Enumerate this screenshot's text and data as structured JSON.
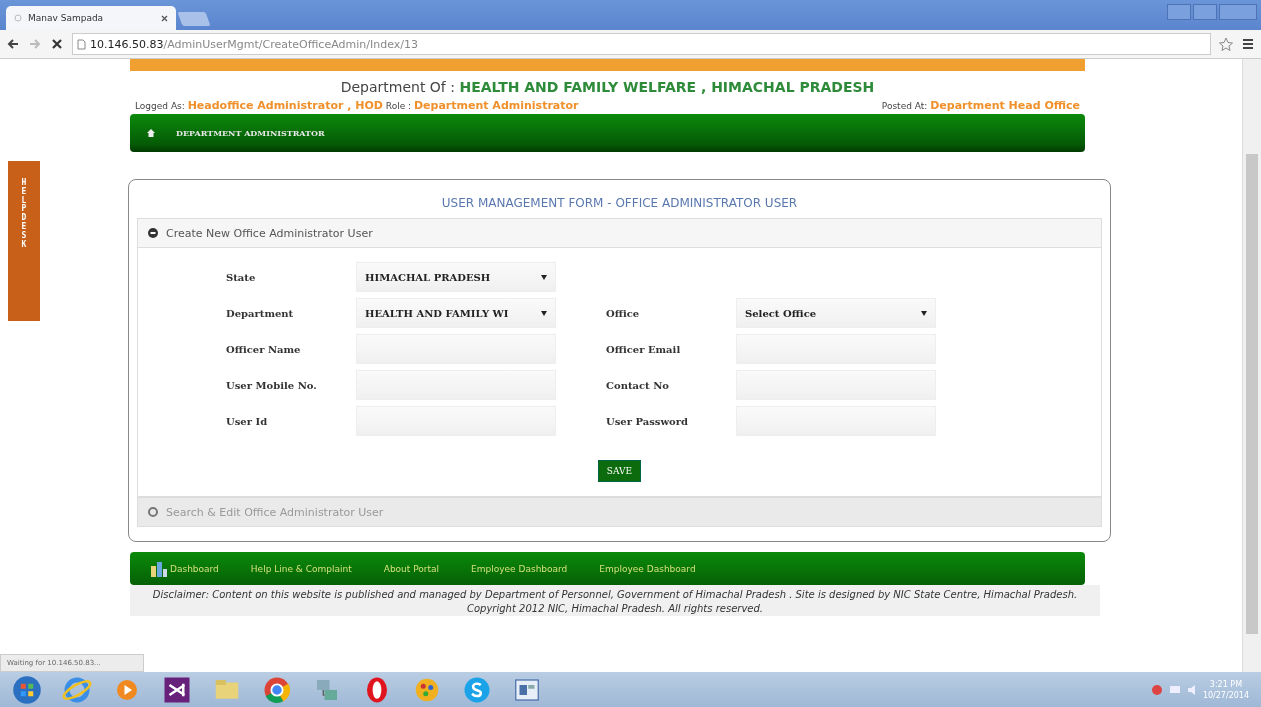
{
  "browser": {
    "tab_title": "Manav Sampada",
    "url_host": "10.146.50.83",
    "url_path": "/AdminUserMgmt/CreateOfficeAdmin/Index/13"
  },
  "header": {
    "department_prefix": "Department Of :",
    "department": "HEALTH AND FAMILY WELFARE , HIMACHAL PRADESH",
    "logged_as_label": "Logged As:",
    "logged_as": "Headoffice Administrator , HOD",
    "role_label": "Role :",
    "role": "Department Administrator",
    "posted_label": "Posted At:",
    "posted": "Department Head Office"
  },
  "help_desk": "HELP DESK",
  "nav": {
    "items": [
      "DEPARTMENT ADMINISTRATOR"
    ]
  },
  "form": {
    "title": "USER MANAGEMENT FORM - OFFICE ADMINISTRATOR USER",
    "sections": [
      {
        "title": "Create New Office Administrator User",
        "expanded": true
      },
      {
        "title": "Search & Edit Office Administrator User",
        "expanded": false
      }
    ],
    "rows": [
      {
        "cells": [
          {
            "label": "State",
            "kind": "select",
            "value": "HIMACHAL PRADESH"
          }
        ]
      },
      {
        "cells": [
          {
            "label": "Department",
            "kind": "select",
            "value": "HEALTH AND FAMILY WI"
          },
          {
            "label": "Office",
            "kind": "select",
            "value": "Select Office"
          }
        ]
      },
      {
        "cells": [
          {
            "label": "Officer Name",
            "kind": "text"
          },
          {
            "label": "Officer Email",
            "kind": "text"
          }
        ]
      },
      {
        "cells": [
          {
            "label": "User Mobile No.",
            "kind": "text"
          },
          {
            "label": "Contact No",
            "kind": "text"
          }
        ]
      },
      {
        "cells": [
          {
            "label": "User Id",
            "kind": "text"
          },
          {
            "label": "User Password",
            "kind": "text"
          }
        ]
      }
    ],
    "save_button": "SAVE"
  },
  "footer": {
    "links": [
      "Dashboard",
      "Help Line & Complaint",
      "About Portal",
      "Employee Dashboard",
      "Employee Dashboard"
    ],
    "disclaimer": "Disclaimer: Content on this website is published and managed by Department of Personnel, Government of Himachal Pradesh . Site is designed by NIC State Centre, Himachal Pradesh.",
    "copyright": "Copyright 2012 NIC, Himachal Pradesh. All rights reserved."
  },
  "status_bar": "Waiting for 10.146.50.83...",
  "taskbar": {
    "time": "3:21 PM",
    "date": "10/27/2014"
  }
}
